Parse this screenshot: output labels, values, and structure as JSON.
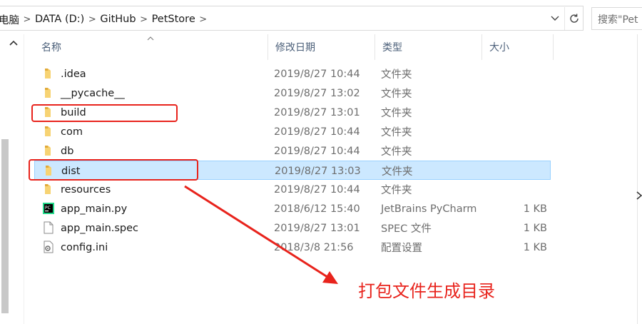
{
  "address_bar": {
    "crumbs": [
      "电脑",
      "DATA (D:)",
      "GitHub",
      "PetStore"
    ],
    "search_placeholder": "搜索\"Pet"
  },
  "columns": {
    "name": "名称",
    "date": "修改日期",
    "type": "类型",
    "size": "大小"
  },
  "files": [
    {
      "name": ".idea",
      "date": "2019/8/27 10:44",
      "type": "文件夹",
      "size": "",
      "icon": "folder-icon",
      "selected": false
    },
    {
      "name": "__pycache__",
      "date": "2019/8/27 13:02",
      "type": "文件夹",
      "size": "",
      "icon": "folder-icon",
      "selected": false
    },
    {
      "name": "build",
      "date": "2019/8/27 13:01",
      "type": "文件夹",
      "size": "",
      "icon": "folder-icon",
      "selected": false
    },
    {
      "name": "com",
      "date": "2019/8/27 10:44",
      "type": "文件夹",
      "size": "",
      "icon": "folder-icon",
      "selected": false
    },
    {
      "name": "db",
      "date": "2019/8/27 10:44",
      "type": "文件夹",
      "size": "",
      "icon": "folder-icon",
      "selected": false
    },
    {
      "name": "dist",
      "date": "2019/8/27 13:03",
      "type": "文件夹",
      "size": "",
      "icon": "folder-icon",
      "selected": true
    },
    {
      "name": "resources",
      "date": "2019/8/27 10:44",
      "type": "文件夹",
      "size": "",
      "icon": "folder-icon",
      "selected": false
    },
    {
      "name": "app_main.py",
      "date": "2018/6/12 15:40",
      "type": "JetBrains PyCharm",
      "size": "1 KB",
      "icon": "pycharm-file-icon",
      "selected": false
    },
    {
      "name": "app_main.spec",
      "date": "2019/8/27 13:01",
      "type": "SPEC 文件",
      "size": "1 KB",
      "icon": "blank-file-icon",
      "selected": false
    },
    {
      "name": "config.ini",
      "date": "2018/3/8 21:56",
      "type": "配置设置",
      "size": "1 KB",
      "icon": "settings-file-icon",
      "selected": false
    }
  ],
  "annotation": {
    "text": "打包文件生成目录",
    "color": "#e8231c"
  },
  "colors": {
    "selected_bg": "#cce8ff",
    "folder": "#f0c050",
    "header_text": "#4c607a"
  }
}
